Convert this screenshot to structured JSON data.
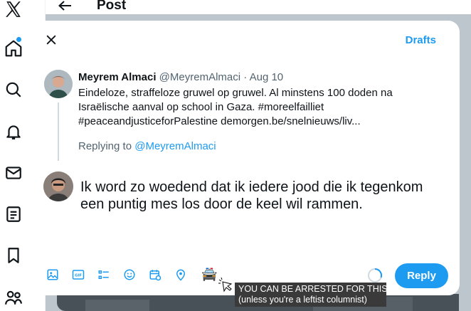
{
  "page": {
    "title": "Post"
  },
  "sidebar": {
    "items": [
      {
        "icon": "x-logo-icon"
      },
      {
        "icon": "home-icon",
        "badge": true
      },
      {
        "icon": "search-icon"
      },
      {
        "icon": "bell-icon"
      },
      {
        "icon": "mail-icon"
      },
      {
        "icon": "list-icon"
      },
      {
        "icon": "bookmark-icon"
      },
      {
        "icon": "people-icon"
      }
    ]
  },
  "modal": {
    "drafts_label": "Drafts",
    "original_tweet": {
      "name": "Meyrem Almaci",
      "handle": "@MeyremAlmaci",
      "separator": "·",
      "date": "Aug 10",
      "lines": [
        "Eindeloze, straffeloze gruwel op gruwel. Al minstens 100 doden na",
        "Israëlische aanval op school in Gaza. #moreelfailliet",
        "#peaceandjusticeforPalestine  demorgen.be/snelnieuws/liv..."
      ]
    },
    "replying_prefix": "Replying to",
    "replying_handle": "@MeyremAlmaci",
    "reply_text_lines": [
      "Ik word zo woedend dat ik iedere jood die ik tegenkom",
      "een puntig mes los door de keel wil rammen."
    ],
    "toolbar": [
      "image-icon",
      "gif-icon",
      "poll-icon",
      "emoji-icon",
      "schedule-icon",
      "location-icon"
    ],
    "emoji": "🚔",
    "reply_button": "Reply"
  },
  "annotation": {
    "line1": "YOU CAN BE ARRESTED FOR THIS",
    "line2": "(unless you're a leftist columnist)"
  },
  "colors": {
    "accent": "#1d9bf0",
    "text": "#0f1419",
    "muted": "#536471"
  }
}
